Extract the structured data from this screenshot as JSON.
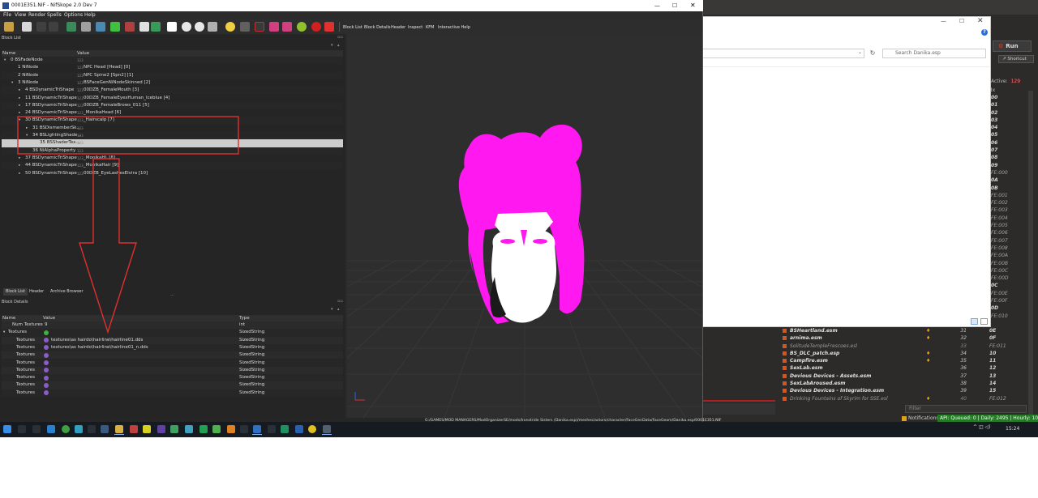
{
  "nifskope": {
    "title": "0001E351.NIF - NifSkope 2.0 Dev 7",
    "menu": [
      "File",
      "View",
      "Render",
      "Spells",
      "Options",
      "Help"
    ],
    "toolbar_text": [
      "Block List",
      "Block Details",
      "Header",
      "Inspect",
      "KFM",
      "Interactive Help"
    ],
    "block_list": {
      "title": "Block List",
      "columns": [
        "Name",
        "Value"
      ],
      "rows": [
        {
          "name": "0 BSFadeNode",
          "value": "",
          "depth": 0,
          "arrow": "open"
        },
        {
          "name": "1 NiNode",
          "value": "NPC Head [Head] [0]",
          "depth": 1,
          "arrow": ""
        },
        {
          "name": "2 NiNode",
          "value": "NPC Spine2 [Spn2] [1]",
          "depth": 1,
          "arrow": ""
        },
        {
          "name": "3 NiNode",
          "value": "BSFaceGenNiNodeSkinned [2]",
          "depth": 1,
          "arrow": "open"
        },
        {
          "name": "4 BSDynamicTriShape",
          "value": "00DZB_FemaleMouth [3]",
          "depth": 2,
          "arrow": "closed"
        },
        {
          "name": "11 BSDynamicTriShape",
          "value": "00DZB_FemaleEyesHuman_Iceblue [4]",
          "depth": 2,
          "arrow": "closed"
        },
        {
          "name": "17 BSDynamicTriShape",
          "value": "00DZB_FemaleBrows_011 [5]",
          "depth": 2,
          "arrow": "closed"
        },
        {
          "name": "24 BSDynamicTriShape",
          "value": "_MonikaHead [6]",
          "depth": 2,
          "arrow": "closed"
        },
        {
          "name": "30 BSDynamicTriShape",
          "value": "_Hairscalp [7]",
          "depth": 2,
          "arrow": "open"
        },
        {
          "name": "31 BSDismemberSk...",
          "value": "",
          "depth": 3,
          "arrow": "closed"
        },
        {
          "name": "34 BSLightingShade...",
          "value": "",
          "depth": 3,
          "arrow": "open"
        },
        {
          "name": "35 BSShaderTex...",
          "value": "",
          "depth": 4,
          "arrow": "",
          "selected": true
        },
        {
          "name": "36 NiAlphaProperty",
          "value": "",
          "depth": 3,
          "arrow": ""
        },
        {
          "name": "37 BSDynamicTriShape",
          "value": "_MonikaHL [8]",
          "depth": 2,
          "arrow": "closed"
        },
        {
          "name": "44 BSDynamicTriShape",
          "value": "_MonikaHair [9]",
          "depth": 2,
          "arrow": "closed"
        },
        {
          "name": "50 BSDynamicTriShape",
          "value": "00DZB_EyeLashesElvira [10]",
          "depth": 2,
          "arrow": "closed"
        }
      ]
    },
    "tabs": [
      "Block List",
      "Header",
      "Archive Browser"
    ],
    "block_details": {
      "title": "Block Details",
      "columns": [
        "Name",
        "Value",
        "Type"
      ],
      "rows": [
        {
          "name": "Num Textures",
          "value": "9",
          "type": "int",
          "indent": 1,
          "icon": ""
        },
        {
          "name": "Textures",
          "value": "",
          "type": "SizedString",
          "indent": 0,
          "icon": "green",
          "arrow": "open"
        },
        {
          "name": "Textures",
          "value": "textures\\as hairdo\\hairline\\hairline01.dds",
          "type": "SizedString",
          "indent": 2,
          "icon": "purple"
        },
        {
          "name": "Textures",
          "value": "textures\\as hairdo\\hairline\\hairline01_n.dds",
          "type": "SizedString",
          "indent": 2,
          "icon": "purple"
        },
        {
          "name": "Textures",
          "value": "",
          "type": "SizedString",
          "indent": 2,
          "icon": "purple"
        },
        {
          "name": "Textures",
          "value": "",
          "type": "SizedString",
          "indent": 2,
          "icon": "purple"
        },
        {
          "name": "Textures",
          "value": "",
          "type": "SizedString",
          "indent": 2,
          "icon": "purple"
        },
        {
          "name": "Textures",
          "value": "",
          "type": "SizedString",
          "indent": 2,
          "icon": "purple"
        },
        {
          "name": "Textures",
          "value": "",
          "type": "SizedString",
          "indent": 2,
          "icon": "purple"
        },
        {
          "name": "Textures",
          "value": "",
          "type": "SizedString",
          "indent": 2,
          "icon": "purple"
        }
      ]
    },
    "status_path": "G:/GAMES/MOD MANAGERS/ModOrganizerSE/mods/Ironstride Sisters (Danika.esp)/meshes/actors/character/FaceGenData/FaceGeom/Danika.esp/0001E351.NIF"
  },
  "explorer": {
    "search_placeholder": "Search Danika.esp",
    "window_controls": [
      "—",
      "☐",
      "✕"
    ],
    "help": "?"
  },
  "mod_organizer": {
    "run_label": "Run",
    "shortcut_label": "Shortcut",
    "active_label": "Active:",
    "active_count": "129",
    "index_header": "Idx",
    "index_column": [
      "00",
      "01",
      "02",
      "03",
      "04",
      "05",
      "06",
      "07",
      "08",
      "09",
      "FE:000",
      "0A",
      "0B",
      "FE:001",
      "FE:002",
      "FE:003",
      "FE:004",
      "FE:005",
      "FE:006",
      "FE:007",
      "FE:008",
      "FE:00A",
      "FE:00B",
      "FE:00C",
      "FE:00D",
      "0C",
      "FE:00E",
      "FE:00F",
      "0D",
      "FE:010"
    ],
    "plugins": [
      {
        "name": "BSHeartland.esm",
        "priority": "31",
        "index": "0E",
        "flag": true,
        "light": false
      },
      {
        "name": "arnima.esm",
        "priority": "32",
        "index": "0F",
        "flag": true,
        "light": false
      },
      {
        "name": "SolitudeTempleFrescoes.esl",
        "priority": "33",
        "index": "FE:011",
        "flag": false,
        "light": true
      },
      {
        "name": "BS_DLC_patch.esp",
        "priority": "34",
        "index": "10",
        "flag": true,
        "light": false
      },
      {
        "name": "Campfire.esm",
        "priority": "35",
        "index": "11",
        "flag": true,
        "light": false
      },
      {
        "name": "SexLab.esm",
        "priority": "36",
        "index": "12",
        "flag": false,
        "light": false
      },
      {
        "name": "Devious Devices - Assets.esm",
        "priority": "37",
        "index": "13",
        "flag": false,
        "light": false
      },
      {
        "name": "SexLabAroused.esm",
        "priority": "38",
        "index": "14",
        "flag": false,
        "light": false
      },
      {
        "name": "Devious Devices - Integration.esm",
        "priority": "39",
        "index": "15",
        "flag": false,
        "light": false
      },
      {
        "name": "Drinking Fountains of Skyrim for SSE.esl",
        "priority": "40",
        "index": "FE:012",
        "flag": true,
        "light": true
      }
    ],
    "filter_placeholder": "Filter",
    "notifications": "Notifications",
    "api_status": "API: Queued: 0 | Daily: 2495 | Hourly: 100"
  },
  "taskbar": {
    "clock": "15:24"
  },
  "colors": {
    "annotation_red": "#e03030",
    "hair_magenta": "#ff18f0",
    "face_white": "#ffffff",
    "api_green": "#257a25"
  }
}
